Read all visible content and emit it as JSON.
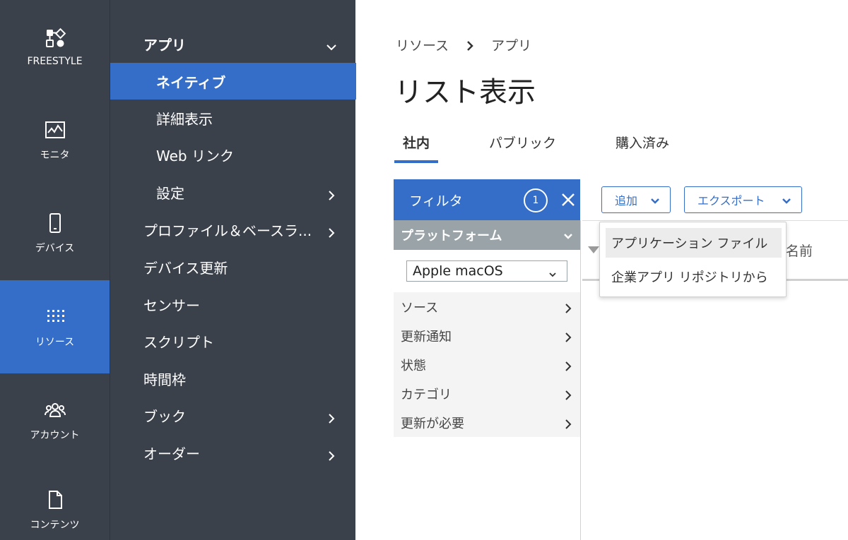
{
  "rail": {
    "items": [
      {
        "label": "FREESTYLE",
        "icon": "freestyle-icon"
      },
      {
        "label": "モニタ",
        "icon": "monitor-icon"
      },
      {
        "label": "デバイス",
        "icon": "device-icon"
      },
      {
        "label": "リソース",
        "icon": "resources-grid-icon",
        "active": true
      },
      {
        "label": "アカウント",
        "icon": "accounts-icon"
      },
      {
        "label": "コンテンツ",
        "icon": "content-icon"
      }
    ]
  },
  "menu": {
    "items": [
      {
        "label": "アプリ",
        "type": "header"
      },
      {
        "label": "ネイティブ",
        "type": "sub",
        "selected": true
      },
      {
        "label": "詳細表示",
        "type": "sub"
      },
      {
        "label": "Web リンク",
        "type": "sub"
      },
      {
        "label": "設定",
        "type": "sub"
      },
      {
        "label": "プロファイル＆ベースラ...",
        "type": "item"
      },
      {
        "label": "デバイス更新",
        "type": "item"
      },
      {
        "label": "センサー",
        "type": "item"
      },
      {
        "label": "スクリプト",
        "type": "item"
      },
      {
        "label": "時間枠",
        "type": "item"
      },
      {
        "label": "ブック",
        "type": "item"
      },
      {
        "label": "オーダー",
        "type": "item"
      }
    ]
  },
  "breadcrumb": {
    "root": "リソース",
    "current": "アプリ"
  },
  "page_title": "リスト表示",
  "tabs": [
    {
      "label": "社内",
      "active": true
    },
    {
      "label": "パブリック"
    },
    {
      "label": "購入済み"
    }
  ],
  "filter": {
    "title": "フィルタ",
    "count": "1",
    "facet_header": "プラットフォーム",
    "platform_value": "Apple macOS",
    "facets": [
      "ソース",
      "更新通知",
      "状態",
      "カテゴリ",
      "更新が必要"
    ]
  },
  "toolbar": {
    "add_label": "追加",
    "export_label": "エクスポート"
  },
  "table": {
    "name_header": "名前"
  },
  "add_menu": {
    "items": [
      "アプリケーション ファイル",
      "企業アプリ リポジトリから"
    ]
  },
  "colors": {
    "accent": "#356ec8",
    "sidebar": "#3b414b",
    "facet_header": "#9aa3a8"
  }
}
